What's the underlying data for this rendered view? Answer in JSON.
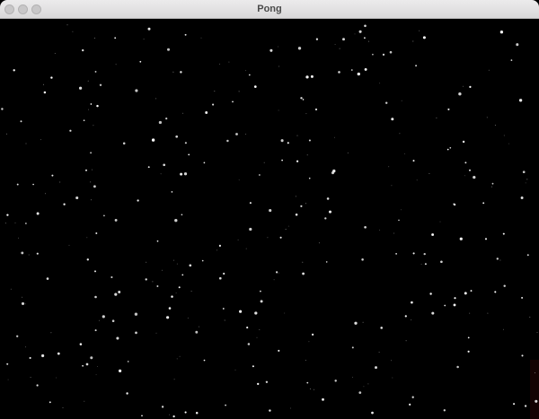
{
  "window": {
    "title": "Pong"
  },
  "colors": {
    "background": "#000000",
    "star": "#ffffff",
    "titlebar": "#e3e2e3",
    "edge_glow": "#5a1010"
  },
  "icons": {
    "close": "close-icon",
    "minimize": "minimize-icon",
    "maximize": "maximize-icon"
  }
}
